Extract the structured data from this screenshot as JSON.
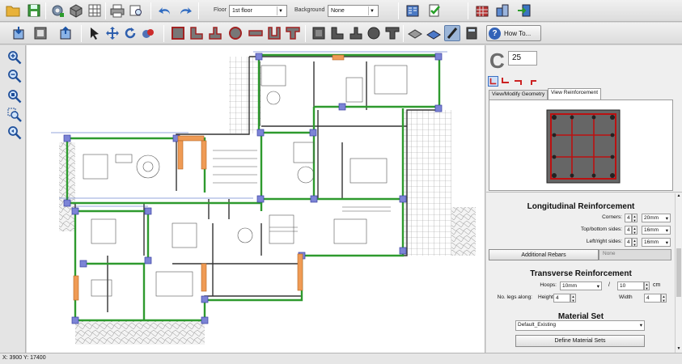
{
  "toolbar": {
    "floor_label": "Floor",
    "floor_value": "1st floor",
    "background_label": "Background",
    "background_value": "None",
    "how_to_label": "How To..."
  },
  "panel": {
    "element_letter": "C",
    "element_number": "25",
    "tabs": [
      "View/Modify Geometry",
      "View Reinforcement"
    ],
    "longitudinal": {
      "title": "Longitudinal Reinforcement",
      "rows": [
        {
          "label": "Corners:",
          "count": "4",
          "diameter": "20mm"
        },
        {
          "label": "Top/bottom sides:",
          "count": "4",
          "diameter": "16mm"
        },
        {
          "label": "Left/right sides:",
          "count": "4",
          "diameter": "16mm"
        }
      ],
      "additional_rebars_label": "Additional Rebars",
      "additional_rebars_value": "None"
    },
    "transverse": {
      "title": "Transverse Reinforcement",
      "hoops_label": "Hoops:",
      "hoops_diameter": "10mm",
      "slash": "/",
      "spacing": "10",
      "unit": "cm",
      "legs_label": "No. legs along:",
      "height_label": "Height",
      "height_value": "4",
      "width_label": "Width",
      "width_value": "4"
    },
    "material": {
      "title": "Material Set",
      "value": "Default_Existing",
      "define_button": "Define Material Sets"
    }
  },
  "status": {
    "coords": "X: 3900  Y: 17400"
  }
}
